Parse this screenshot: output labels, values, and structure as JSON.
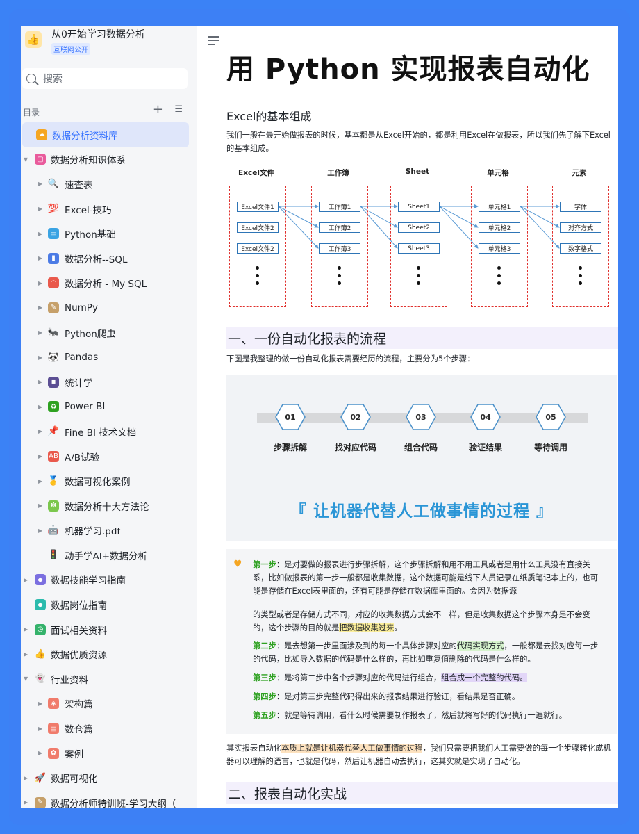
{
  "workspace": {
    "title": "从0开始学习数据分析",
    "badge": "互联网公开"
  },
  "search": {
    "placeholder": "搜索"
  },
  "toc": {
    "label": "目录"
  },
  "tree": [
    {
      "label": "数据分析资料库",
      "level": 0,
      "expand": "",
      "icon": "☁",
      "color": "#f5a623",
      "selected": true
    },
    {
      "label": "数据分析知识体系",
      "level": 0,
      "expand": "▼",
      "icon": "▢",
      "color": "#e95b9c"
    },
    {
      "label": "速查表",
      "level": 1,
      "expand": "▶",
      "icon": "🔍",
      "color": "transparent"
    },
    {
      "label": "Excel-技巧",
      "level": 1,
      "expand": "▶",
      "icon": "💯",
      "color": "transparent"
    },
    {
      "label": "Python基础",
      "level": 1,
      "expand": "▶",
      "icon": "▭",
      "color": "#3aa3e3"
    },
    {
      "label": "数据分析--SQL",
      "level": 1,
      "expand": "▶",
      "icon": "▮",
      "color": "#4b7be5"
    },
    {
      "label": "数据分析 - My SQL",
      "level": 1,
      "expand": "▶",
      "icon": "◠",
      "color": "#e9594c"
    },
    {
      "label": "NumPy",
      "level": 1,
      "expand": "▶",
      "icon": "✎",
      "color": "#c6a06a"
    },
    {
      "label": "Python爬虫",
      "level": 1,
      "expand": "▶",
      "icon": "🐜",
      "color": "transparent"
    },
    {
      "label": "Pandas",
      "level": 1,
      "expand": "▶",
      "icon": "🐼",
      "color": "transparent"
    },
    {
      "label": "统计学",
      "level": 1,
      "expand": "▶",
      "icon": "▪",
      "color": "#5c4f94"
    },
    {
      "label": "Power BI",
      "level": 1,
      "expand": "▶",
      "icon": "♻",
      "color": "#2ea121"
    },
    {
      "label": "Fine BI 技术文档",
      "level": 1,
      "expand": "▶",
      "icon": "📌",
      "color": "transparent"
    },
    {
      "label": "A/B试验",
      "level": 1,
      "expand": "▶",
      "icon": "AB",
      "color": "#e9594c"
    },
    {
      "label": "数据可视化案例",
      "level": 1,
      "expand": "▶",
      "icon": "🥇",
      "color": "transparent"
    },
    {
      "label": "数据分析十大方法论",
      "level": 1,
      "expand": "▶",
      "icon": "❇",
      "color": "#7bc74d"
    },
    {
      "label": "机器学习.pdf",
      "level": 1,
      "expand": "▶",
      "icon": "🤖",
      "color": "transparent"
    },
    {
      "label": "动手学AI+数据分析",
      "level": 1,
      "expand": "",
      "icon": "🚦",
      "color": "transparent"
    },
    {
      "label": "数据技能学习指南",
      "level": 0,
      "expand": "▶",
      "icon": "◆",
      "color": "#7b6fe0"
    },
    {
      "label": "数据岗位指南",
      "level": 0,
      "expand": "",
      "icon": "◆",
      "color": "#2bbbad"
    },
    {
      "label": "面试相关资料",
      "level": 0,
      "expand": "▶",
      "icon": "◷",
      "color": "#34b26b"
    },
    {
      "label": "数据优质资源",
      "level": 0,
      "expand": "▶",
      "icon": "👍",
      "color": "transparent"
    },
    {
      "label": "行业资料",
      "level": 0,
      "expand": "▼",
      "icon": "👻",
      "color": "transparent"
    },
    {
      "label": "架构篇",
      "level": 1,
      "expand": "▶",
      "icon": "◈",
      "color": "#f07b6b"
    },
    {
      "label": "数仓篇",
      "level": 1,
      "expand": "▶",
      "icon": "▤",
      "color": "#f07b6b"
    },
    {
      "label": "案例",
      "level": 1,
      "expand": "▶",
      "icon": "✿",
      "color": "#f07b6b"
    },
    {
      "label": "数据可视化",
      "level": 0,
      "expand": "▶",
      "icon": "🚀",
      "color": "transparent"
    },
    {
      "label": "数据分析师特训班-学习大纲（",
      "level": 0,
      "expand": "▶",
      "icon": "✎",
      "color": "#c6a06a"
    }
  ],
  "doc": {
    "title": "用 Python 实现报表自动化",
    "section_excel": "Excel的基本组成",
    "excel_intro": "我们一般在最开始做报表的时候，基本都是从Excel开始的，都是利用Excel在做报表，所以我们先了解下Excel的基本组成。",
    "diagram": {
      "columns": [
        "Excel文件",
        "工作簿",
        "Sheet",
        "单元格",
        "元素"
      ],
      "col0": [
        "Excel文件1",
        "Excel文件2",
        "Excel文件2"
      ],
      "col1": [
        "工作簿1",
        "工作簿2",
        "工作簿3"
      ],
      "col2": [
        "Sheet1",
        "Sheet2",
        "Sheet3"
      ],
      "col3": [
        "单元格1",
        "单元格2",
        "单元格3"
      ],
      "col4": [
        "字体",
        "对齐方式",
        "数字格式"
      ]
    },
    "h2_1": "一、一份自动化报表的流程",
    "flow_intro": "下图是我整理的做一份自动化报表需要经历的流程，主要分为5个步骤：",
    "process": {
      "nums": [
        "01",
        "02",
        "03",
        "04",
        "05"
      ],
      "labels": [
        "步骤拆解",
        "找对应代码",
        "组合代码",
        "验证结果",
        "等待调用"
      ],
      "banner": "『 让机器代替人工做事情的过程 』"
    },
    "steps": {
      "s1_label": "第一步",
      "s1_a": "：是对要做的报表进行步骤拆解，这个步骤拆解和用不用工具或者是用什么工具没有直接关系，比如做报表的第一步一般都是收集数据，这个数据可能是线下人员记录在纸质笔记本上的，也可能是存储在Excel表里面的，还有可能是存储在数据库里面的。会因为数据源",
      "s1_b": "的类型或者是存储方式不同，对应的收集数据方式会不一样，但是收集数据这个步骤本身是不会变的，这个步骤的目的就是",
      "s1_hl": "把数据收集过来",
      "s1_end": "。",
      "s2_label": "第二步",
      "s2_a": "：是去想第一步里面涉及到的每一个具体步骤对应的",
      "s2_hl": "代码实现方式",
      "s2_b": "，一般都是去找对应每一步的代码，比如导入数据的代码是什么样的，再比如重复值删除的代码是什么样的。",
      "s3_label": "第三步",
      "s3_a": "：是将第二步中各个步骤对应的代码进行组合，",
      "s3_hl": "组合成一个完整的代码。",
      "s4_label": "第四步",
      "s4_a": "：是对第三步完整代码得出来的报表结果进行验证，看结果是否正确。",
      "s5_label": "第五步",
      "s5_a": "：就是等待调用，看什么时候需要制作报表了，然后就将写好的代码执行一遍就行。"
    },
    "summary_a": "其实报表自动化",
    "summary_hl": "本质上就是让机器代替人工做事情的过程",
    "summary_b": "，我们只需要把我们人工需要做的每一个步骤转化成机器可以理解的语言，也就是代码，然后让机器自动去执行，这其实就是实现了自动化。",
    "h2_2": "二、报表自动化实战"
  }
}
